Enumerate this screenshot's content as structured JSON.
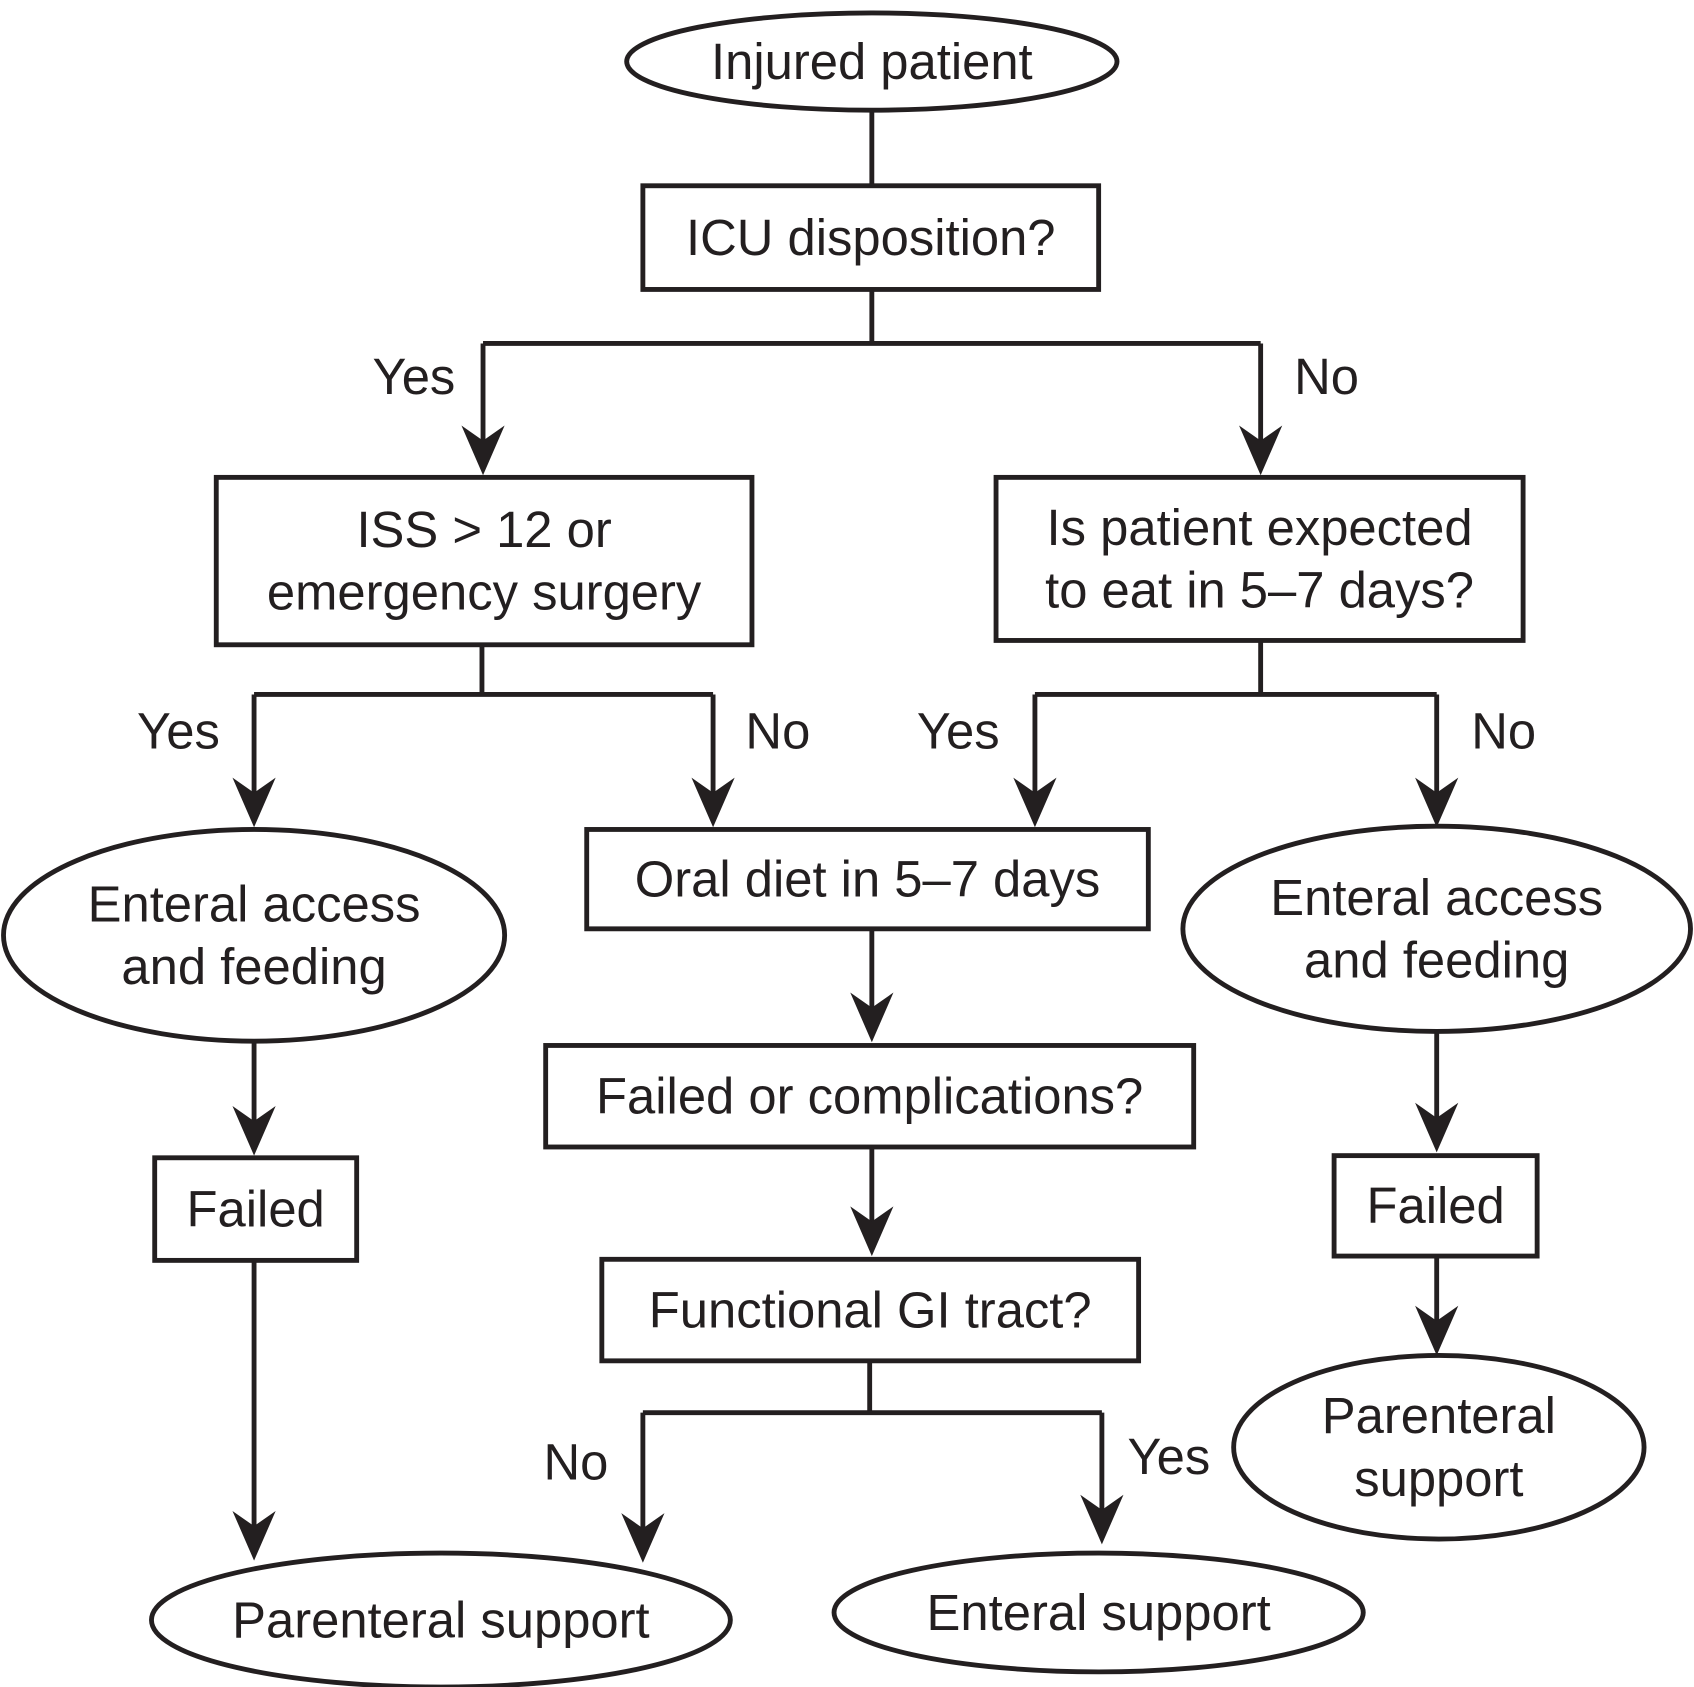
{
  "nodes": {
    "start": [
      "Injured patient"
    ],
    "icu": [
      "ICU disposition?"
    ],
    "iss": [
      "ISS > 12 or",
      "emergency surgery"
    ],
    "expected": [
      "Is patient expected",
      "to eat in 5–7 days?"
    ],
    "enteral_left": [
      "Enteral access",
      "and feeding"
    ],
    "oral": [
      "Oral diet in 5–7 days"
    ],
    "enteral_right": [
      "Enteral access",
      "and feeding"
    ],
    "failed_left": [
      "Failed"
    ],
    "failed_center": [
      "Failed or complications?"
    ],
    "failed_right": [
      "Failed"
    ],
    "functional": [
      "Functional GI tract?"
    ],
    "parenteral_right": [
      "Parenteral",
      "support"
    ],
    "parenteral_bottom": [
      "Parenteral support"
    ],
    "enteral_support": [
      "Enteral support"
    ]
  },
  "edge_labels": {
    "icu_yes": "Yes",
    "icu_no": "No",
    "iss_yes": "Yes",
    "iss_no": "No",
    "expected_yes": "Yes",
    "expected_no": "No",
    "functional_no": "No",
    "functional_yes": "Yes"
  },
  "colors": {
    "ink": "#231f20",
    "background": "#ffffff"
  }
}
